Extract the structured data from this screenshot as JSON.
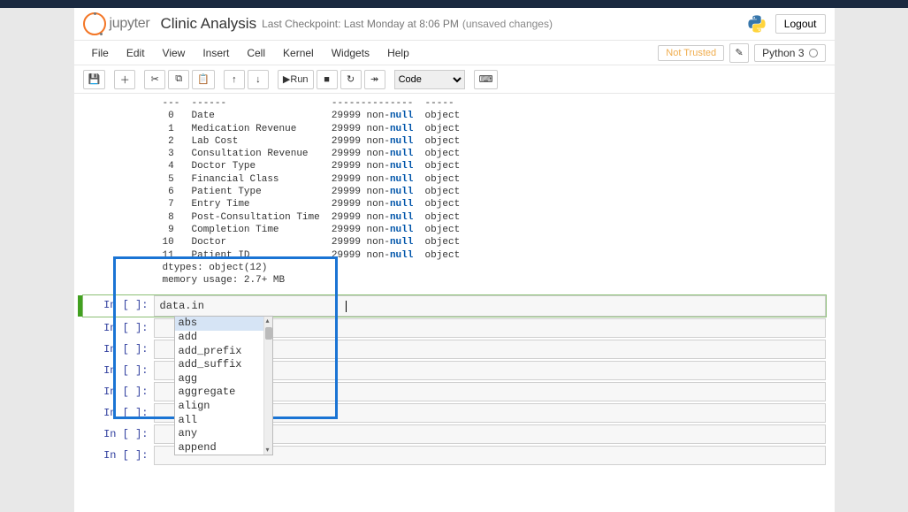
{
  "header": {
    "logo_text": "jupyter",
    "notebook_name": "Clinic Analysis",
    "checkpoint": "Last Checkpoint: Last Monday at 8:06 PM",
    "unsaved": "(unsaved changes)",
    "logout": "Logout"
  },
  "menubar": {
    "items": [
      "File",
      "Edit",
      "View",
      "Insert",
      "Cell",
      "Kernel",
      "Widgets",
      "Help"
    ],
    "not_trusted": "Not Trusted",
    "kernel": "Python 3"
  },
  "toolbar": {
    "run_label": "Run",
    "celltype": "Code"
  },
  "output": {
    "header_row": "---  ------                  --------------  -----",
    "cols": [
      {
        "idx": " 0",
        "name": "Date                  ",
        "nn": "29999 non-",
        "nullw": "null",
        "dtype": "  object"
      },
      {
        "idx": " 1",
        "name": "Medication Revenue    ",
        "nn": "29999 non-",
        "nullw": "null",
        "dtype": "  object"
      },
      {
        "idx": " 2",
        "name": "Lab Cost              ",
        "nn": "29999 non-",
        "nullw": "null",
        "dtype": "  object"
      },
      {
        "idx": " 3",
        "name": "Consultation Revenue  ",
        "nn": "29999 non-",
        "nullw": "null",
        "dtype": "  object"
      },
      {
        "idx": " 4",
        "name": "Doctor Type           ",
        "nn": "29999 non-",
        "nullw": "null",
        "dtype": "  object"
      },
      {
        "idx": " 5",
        "name": "Financial Class       ",
        "nn": "29999 non-",
        "nullw": "null",
        "dtype": "  object"
      },
      {
        "idx": " 6",
        "name": "Patient Type          ",
        "nn": "29999 non-",
        "nullw": "null",
        "dtype": "  object"
      },
      {
        "idx": " 7",
        "name": "Entry Time            ",
        "nn": "29999 non-",
        "nullw": "null",
        "dtype": "  object"
      },
      {
        "idx": " 8",
        "name": "Post-Consultation Time",
        "nn": "29999 non-",
        "nullw": "null",
        "dtype": "  object"
      },
      {
        "idx": " 9",
        "name": "Completion Time       ",
        "nn": "29999 non-",
        "nullw": "null",
        "dtype": "  object"
      },
      {
        "idx": "10",
        "name": "Doctor                ",
        "nn": "29999 non-",
        "nullw": "null",
        "dtype": "  object"
      },
      {
        "idx": "11",
        "name": "Patient ID            ",
        "nn": "29999 non-",
        "nullw": "null",
        "dtype": "  object"
      }
    ],
    "dtypes_line": "dtypes: object(12)",
    "memory_line": "memory usage: 2.7+ MB"
  },
  "cells": {
    "prompt_label": "In [ ]:",
    "active_code": "data.in"
  },
  "autocomplete": {
    "options": [
      "abs",
      "add",
      "add_prefix",
      "add_suffix",
      "agg",
      "aggregate",
      "align",
      "all",
      "any",
      "append"
    ]
  }
}
